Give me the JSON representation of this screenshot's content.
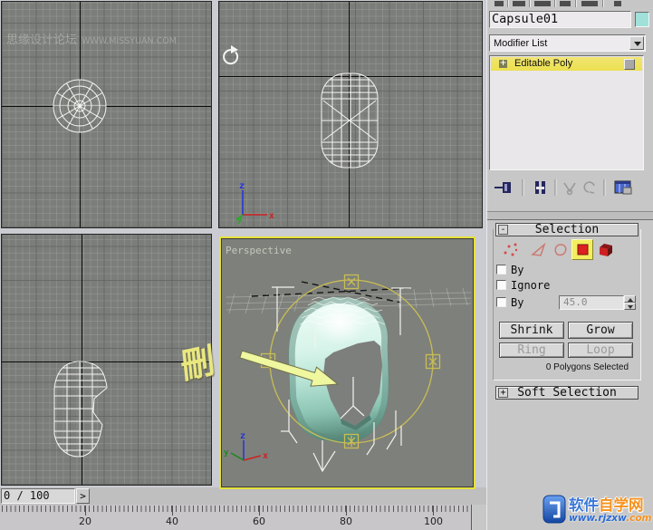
{
  "watermark": {
    "forum": "思缘设计论坛",
    "site": "WWW.MISSYUAN.COM"
  },
  "viewport_labels": {
    "perspective": "Perspective"
  },
  "axis": {
    "x": "x",
    "y": "y",
    "z": "z"
  },
  "annotation": {
    "text": "刪"
  },
  "panel": {
    "object_name": "Capsule01",
    "modifier_list": "Modifier List",
    "stack_item": "Editable Poly",
    "stack_expand": "+",
    "selection": {
      "collapse": "-",
      "title": "Selection",
      "cb_by_vertex": "By",
      "cb_ignore": "Ignore",
      "cb_by_angle": "By",
      "angle_value": "45.0",
      "shrink": "Shrink",
      "grow": "Grow",
      "ring": "Ring",
      "loop": "Loop",
      "status": "0 Polygons Selected"
    },
    "soft_selection": {
      "expand": "+",
      "title": "Soft Selection"
    }
  },
  "timeline": {
    "frames": "0 / 100",
    "next": ">",
    "ticks": [
      "20",
      "40",
      "60",
      "80",
      "100"
    ]
  },
  "logo": {
    "name_a": "软件",
    "name_b": "自学",
    "name_c": "网",
    "url_a": "www.",
    "url_b": "rjzxw",
    "url_c": ".com"
  }
}
